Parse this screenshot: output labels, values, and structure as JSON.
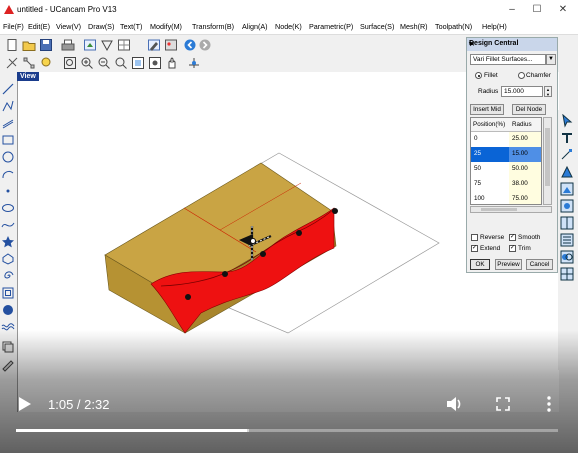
{
  "window": {
    "title": "untitled - UCancam Pro V13"
  },
  "menu": [
    "File(F)",
    "Edit(E)",
    "View(V)",
    "Draw(S)",
    "Text(T)",
    "Modify(M)",
    "Transform(B)",
    "Align(A)",
    "Node(K)",
    "Parametric(P)",
    "Surface(S)",
    "Mesh(R)",
    "Toolpath(N)",
    "Help(H)"
  ],
  "viewport": {
    "tab_label": "View"
  },
  "panel": {
    "title": "Design Central",
    "combo_value": "Vari Fillet Surfaces...",
    "radio_fillet": "Fillet",
    "radio_chamfer": "Chamfer",
    "radius_label": "Radius",
    "radius_value": "15.000",
    "insert_btn": "Insert Mid",
    "del_btn": "Del Node",
    "col_position": "Position(%)",
    "col_radius": "Radius",
    "rows": [
      {
        "position": "0",
        "radius": "25.00"
      },
      {
        "position": "25",
        "radius": "15.00"
      },
      {
        "position": "50",
        "radius": "50.00"
      },
      {
        "position": "75",
        "radius": "38.00"
      },
      {
        "position": "100",
        "radius": "75.00"
      }
    ],
    "selected_row": 1,
    "chk_reverse": "Reverse",
    "chk_smooth": "Smooth",
    "chk_extend": "Extend",
    "chk_trim": "Trim",
    "ok_btn": "OK",
    "preview_btn": "Preview",
    "cancel_btn": "Cancel"
  },
  "player": {
    "time_text": "1:05 / 2:32",
    "progress": 0.427,
    "buffered": 0.43
  },
  "colors": {
    "solid": "#c9a444",
    "fillet": "#ee1111",
    "selection": "#0a64d6",
    "panel_title": "#c9d6ea"
  }
}
